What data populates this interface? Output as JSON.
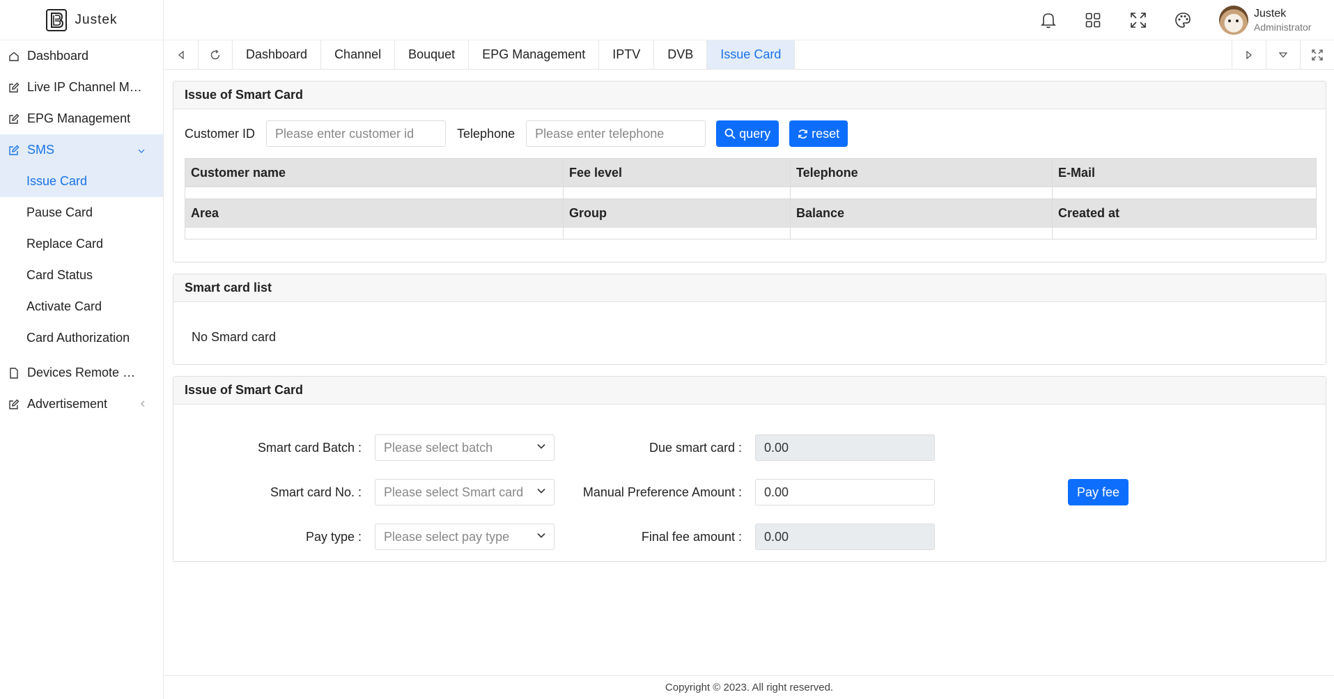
{
  "app": {
    "name": "Justek"
  },
  "sidebar": {
    "items": [
      {
        "label": "Dashboard",
        "icon": "home-icon"
      },
      {
        "label": "Live IP Channel Man...",
        "icon": "edit-icon"
      },
      {
        "label": "EPG Management",
        "icon": "edit-icon"
      },
      {
        "label": "SMS",
        "icon": "edit-icon",
        "expanded": true
      },
      {
        "label": "Devices Remote Ma...",
        "icon": "document-icon"
      },
      {
        "label": "Advertisement",
        "icon": "edit-icon"
      }
    ],
    "sms_sub": [
      "Issue Card",
      "Pause Card",
      "Replace Card",
      "Card Status",
      "Activate Card",
      "Card Authorization"
    ]
  },
  "header": {
    "icons": [
      "bell-icon",
      "grid-icon",
      "expand-icon",
      "palette-icon"
    ],
    "user": {
      "name": "Justek",
      "role": "Administrator"
    }
  },
  "tabs": [
    "Dashboard",
    "Channel",
    "Bouquet",
    "EPG Management",
    "IPTV",
    "DVB",
    "Issue Card"
  ],
  "active_tab": "Issue Card",
  "search_panel": {
    "title": "Issue of Smart Card",
    "customer_id_label": "Customer ID",
    "customer_id_placeholder": "Please enter customer id",
    "telephone_label": "Telephone",
    "telephone_placeholder": "Please enter telephone",
    "query_label": "query",
    "reset_label": "reset",
    "row1": [
      "Customer name",
      "Fee level",
      "Telephone",
      "E-Mail"
    ],
    "row2": [
      "Area",
      "Group",
      "Balance",
      "Created at"
    ]
  },
  "card_list": {
    "title": "Smart card list",
    "empty_text": "No Smard card"
  },
  "issue_panel": {
    "title": "Issue of Smart Card",
    "batch_label": "Smart card Batch :",
    "batch_placeholder": "Please select batch",
    "cardno_label": "Smart card No. :",
    "cardno_placeholder": "Please select Smart card",
    "paytype_label": "Pay type :",
    "paytype_placeholder": "Please select pay type",
    "due_label": "Due smart card :",
    "due_value": "0.00",
    "manual_label": "Manual Preference Amount :",
    "manual_value": "0.00",
    "final_label": "Final fee amount :",
    "final_value": "0.00",
    "payfee_label": "Pay fee"
  },
  "footer": {
    "text": "Copyright © 2023. All right reserved."
  },
  "colors": {
    "accent": "#0d6efd",
    "active_bg": "#e3ecf8",
    "active_text": "#1a73e8"
  }
}
